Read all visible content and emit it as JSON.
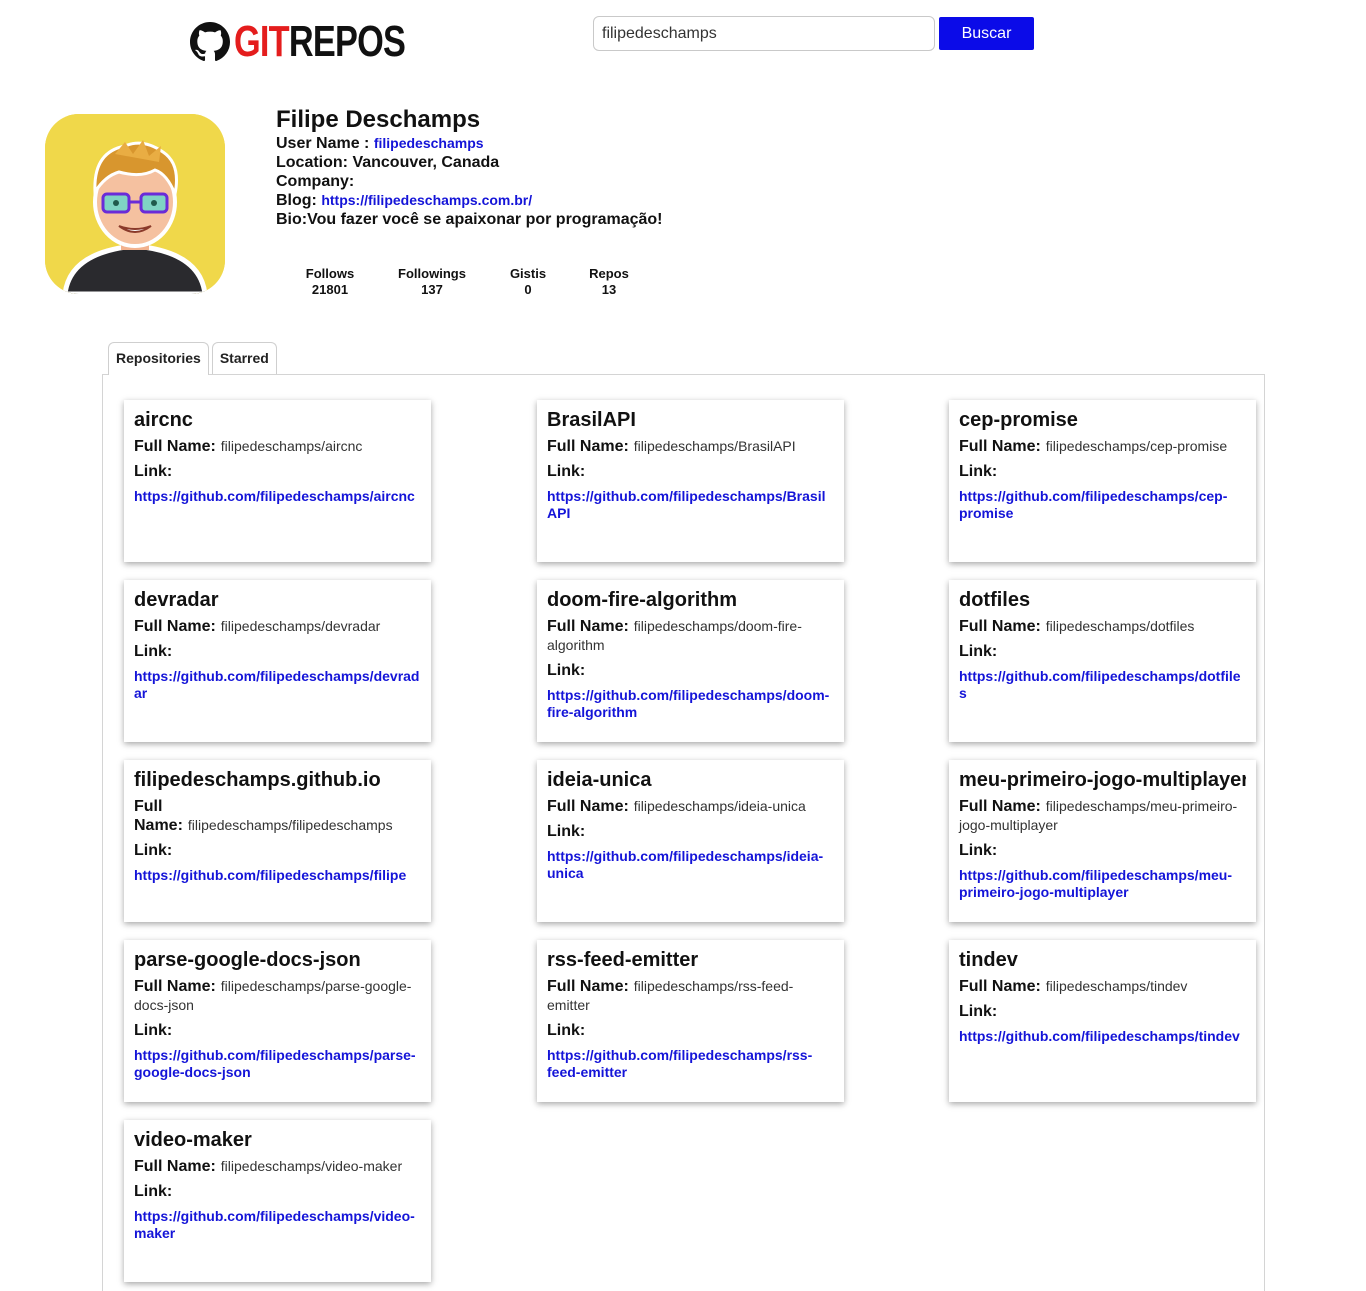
{
  "header": {
    "logo_git": "GIT",
    "logo_repos": "REPOS",
    "search_value": "filipedeschamps",
    "search_button": "Buscar"
  },
  "profile": {
    "name": "Filipe Deschamps",
    "username_label": "User Name : ",
    "username": "filipedeschamps",
    "location_label": "Location: ",
    "location": "Vancouver, Canada",
    "company_label": "Company:",
    "company": "",
    "blog_label": "Blog: ",
    "blog": "https://filipedeschamps.com.br/",
    "bio_label": "Bio:",
    "bio": "Vou fazer você se apaixonar por programação!"
  },
  "stats": [
    {
      "label": "Follows",
      "value": "21801"
    },
    {
      "label": "Followings",
      "value": "137"
    },
    {
      "label": "Gistis",
      "value": "0"
    },
    {
      "label": "Repos",
      "value": "13"
    }
  ],
  "tabs": [
    "Repositories",
    "Starred"
  ],
  "card_labels": {
    "full_name": "Full Name:",
    "link": "Link:"
  },
  "repos": [
    {
      "name": "aircnc",
      "full_name": "filipedeschamps/aircnc",
      "link": "https://github.com/filipedeschamps/aircnc"
    },
    {
      "name": "BrasilAPI",
      "full_name": "filipedeschamps/BrasilAPI",
      "link": "https://github.com/filipedeschamps/BrasilAPI"
    },
    {
      "name": "cep-promise",
      "full_name": "filipedeschamps/cep-promise",
      "link": "https://github.com/filipedeschamps/cep-promise"
    },
    {
      "name": "devradar",
      "full_name": "filipedeschamps/devradar",
      "link": "https://github.com/filipedeschamps/devradar"
    },
    {
      "name": "doom-fire-algorithm",
      "full_name": "filipedeschamps/doom-fire-algorithm",
      "link": "https://github.com/filipedeschamps/doom-fire-algorithm"
    },
    {
      "name": "dotfiles",
      "full_name": "filipedeschamps/dotfiles",
      "link": "https://github.com/filipedeschamps/dotfiles"
    },
    {
      "name": "filipedeschamps.github.io",
      "full_name": "filipedeschamps/filipedeschamps",
      "link": "https://github.com/filipedeschamps/filipe"
    },
    {
      "name": "ideia-unica",
      "full_name": "filipedeschamps/ideia-unica",
      "link": "https://github.com/filipedeschamps/ideia-unica"
    },
    {
      "name": "meu-primeiro-jogo-multiplayer",
      "full_name": "filipedeschamps/meu-primeiro-jogo-multiplayer",
      "link": "https://github.com/filipedeschamps/meu-primeiro-jogo-multiplayer"
    },
    {
      "name": "parse-google-docs-json",
      "full_name": "filipedeschamps/parse-google-docs-json",
      "link": "https://github.com/filipedeschamps/parse-google-docs-json"
    },
    {
      "name": "rss-feed-emitter",
      "full_name": "filipedeschamps/rss-feed-emitter",
      "link": "https://github.com/filipedeschamps/rss-feed-emitter"
    },
    {
      "name": "tindev",
      "full_name": "filipedeschamps/tindev",
      "link": "https://github.com/filipedeschamps/tindev"
    },
    {
      "name": "video-maker",
      "full_name": "filipedeschamps/video-maker",
      "link": "https://github.com/filipedeschamps/video-maker"
    }
  ],
  "colors": {
    "accent": "#0b0be8",
    "link": "#1414d8",
    "logo_red": "#e41d1d",
    "avatar_bg": "#f0d84a"
  }
}
